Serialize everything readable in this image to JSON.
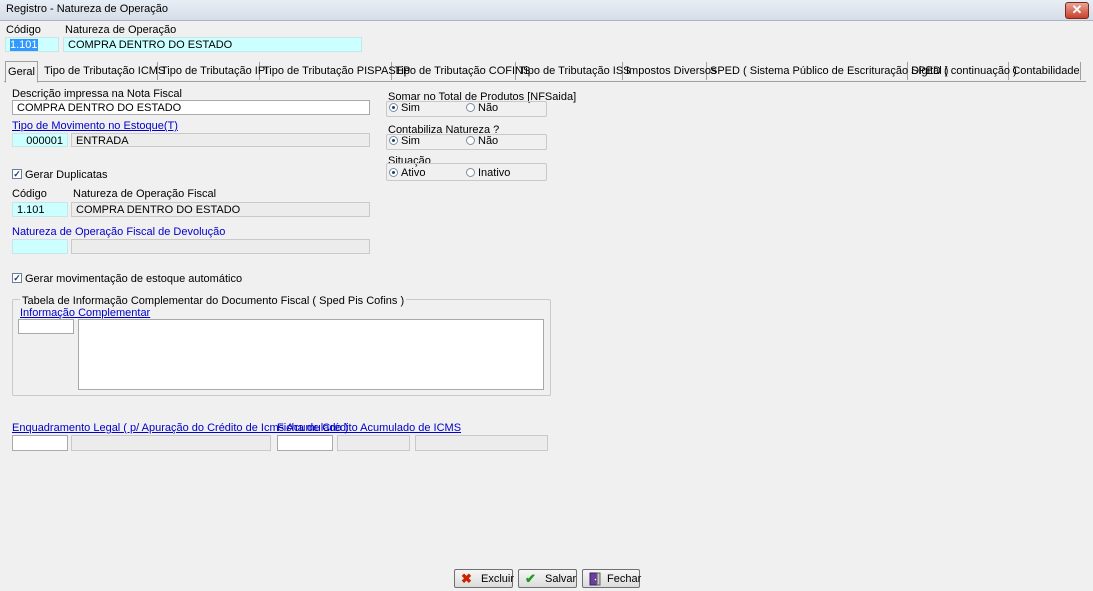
{
  "window": {
    "title": "Registro - Natureza de Operação",
    "close_glyph": "✕"
  },
  "header": {
    "codigo_label": "Código",
    "natureza_label": "Natureza de Operação",
    "codigo_value": "1.101",
    "natureza_value": "COMPRA DENTRO DO ESTADO"
  },
  "tabs": [
    {
      "label": "Geral"
    },
    {
      "label": "Tipo de Tributação  ICMS"
    },
    {
      "label": "Tipo de Tributação IPI"
    },
    {
      "label": "Tipo de Tributação PISPASEP"
    },
    {
      "label": "Tipo de Tributação COFINS"
    },
    {
      "label": "Tipo de Tributação ISS"
    },
    {
      "label": "Impostos Diversos"
    },
    {
      "label": "SPED ( Sistema Público de Escrituração Digital )"
    },
    {
      "label": "SPED ( continuação )"
    },
    {
      "label": "Contabilidade"
    }
  ],
  "geral": {
    "descricao_label": "Descrição impressa na Nota Fiscal",
    "descricao_value": "COMPRA DENTRO DO ESTADO",
    "tipo_mov_label": "Tipo de Movimento no Estoque(T)",
    "tipo_mov_code": "000001",
    "tipo_mov_desc": "ENTRADA",
    "gerar_duplicatas_label": "Gerar Duplicatas",
    "gerar_duplicatas_checked": true,
    "codigo_label": "Código",
    "nat_fiscal_label": "Natureza de Operação Fiscal",
    "codigo_fiscal_value": "1.101",
    "nat_fiscal_value": "COMPRA DENTRO DO ESTADO",
    "devolucao_label": "Natureza de Operação Fiscal de Devolução",
    "devolucao_code": "",
    "devolucao_desc": "",
    "gerar_mov_label": "Gerar movimentação de estoque automático",
    "gerar_mov_checked": true,
    "tabela_label": "Tabela de Informação Complementar do Documento Fiscal ( Sped Pis Cofins )",
    "info_comp_label": "Informação Complementar",
    "info_comp_code": "",
    "info_comp_text": "",
    "enquadramento_label": "Enquadramento Legal ( p/ Apuração do Crédito de Icms Acumulado )",
    "ficha_label": "Ficha de Crédito Acumulado de ICMS",
    "enq_code": "",
    "enq_desc": "",
    "ficha_code": "",
    "ficha_f2": "",
    "ficha_f3": ""
  },
  "somar": {
    "label": "Somar no Total de Produtos [NFSaida]",
    "sim": "Sim",
    "nao": "Não",
    "selected": "Sim"
  },
  "contabiliza": {
    "label": "Contabiliza Natureza ?",
    "sim": "Sim",
    "nao": "Não",
    "selected": "Sim"
  },
  "situacao": {
    "label": "Situação",
    "ativo": "Ativo",
    "inativo": "Inativo",
    "selected": "Ativo"
  },
  "buttons": {
    "excluir": "Excluir",
    "salvar": "Salvar",
    "fechar": "Fechar"
  },
  "icons": {
    "excluir": "close-x-icon",
    "salvar": "checkmark-icon",
    "fechar": "door-exit-icon"
  },
  "colors": {
    "required_field": "#ccffff",
    "link": "#0000cc",
    "selection": "#3399ff"
  }
}
